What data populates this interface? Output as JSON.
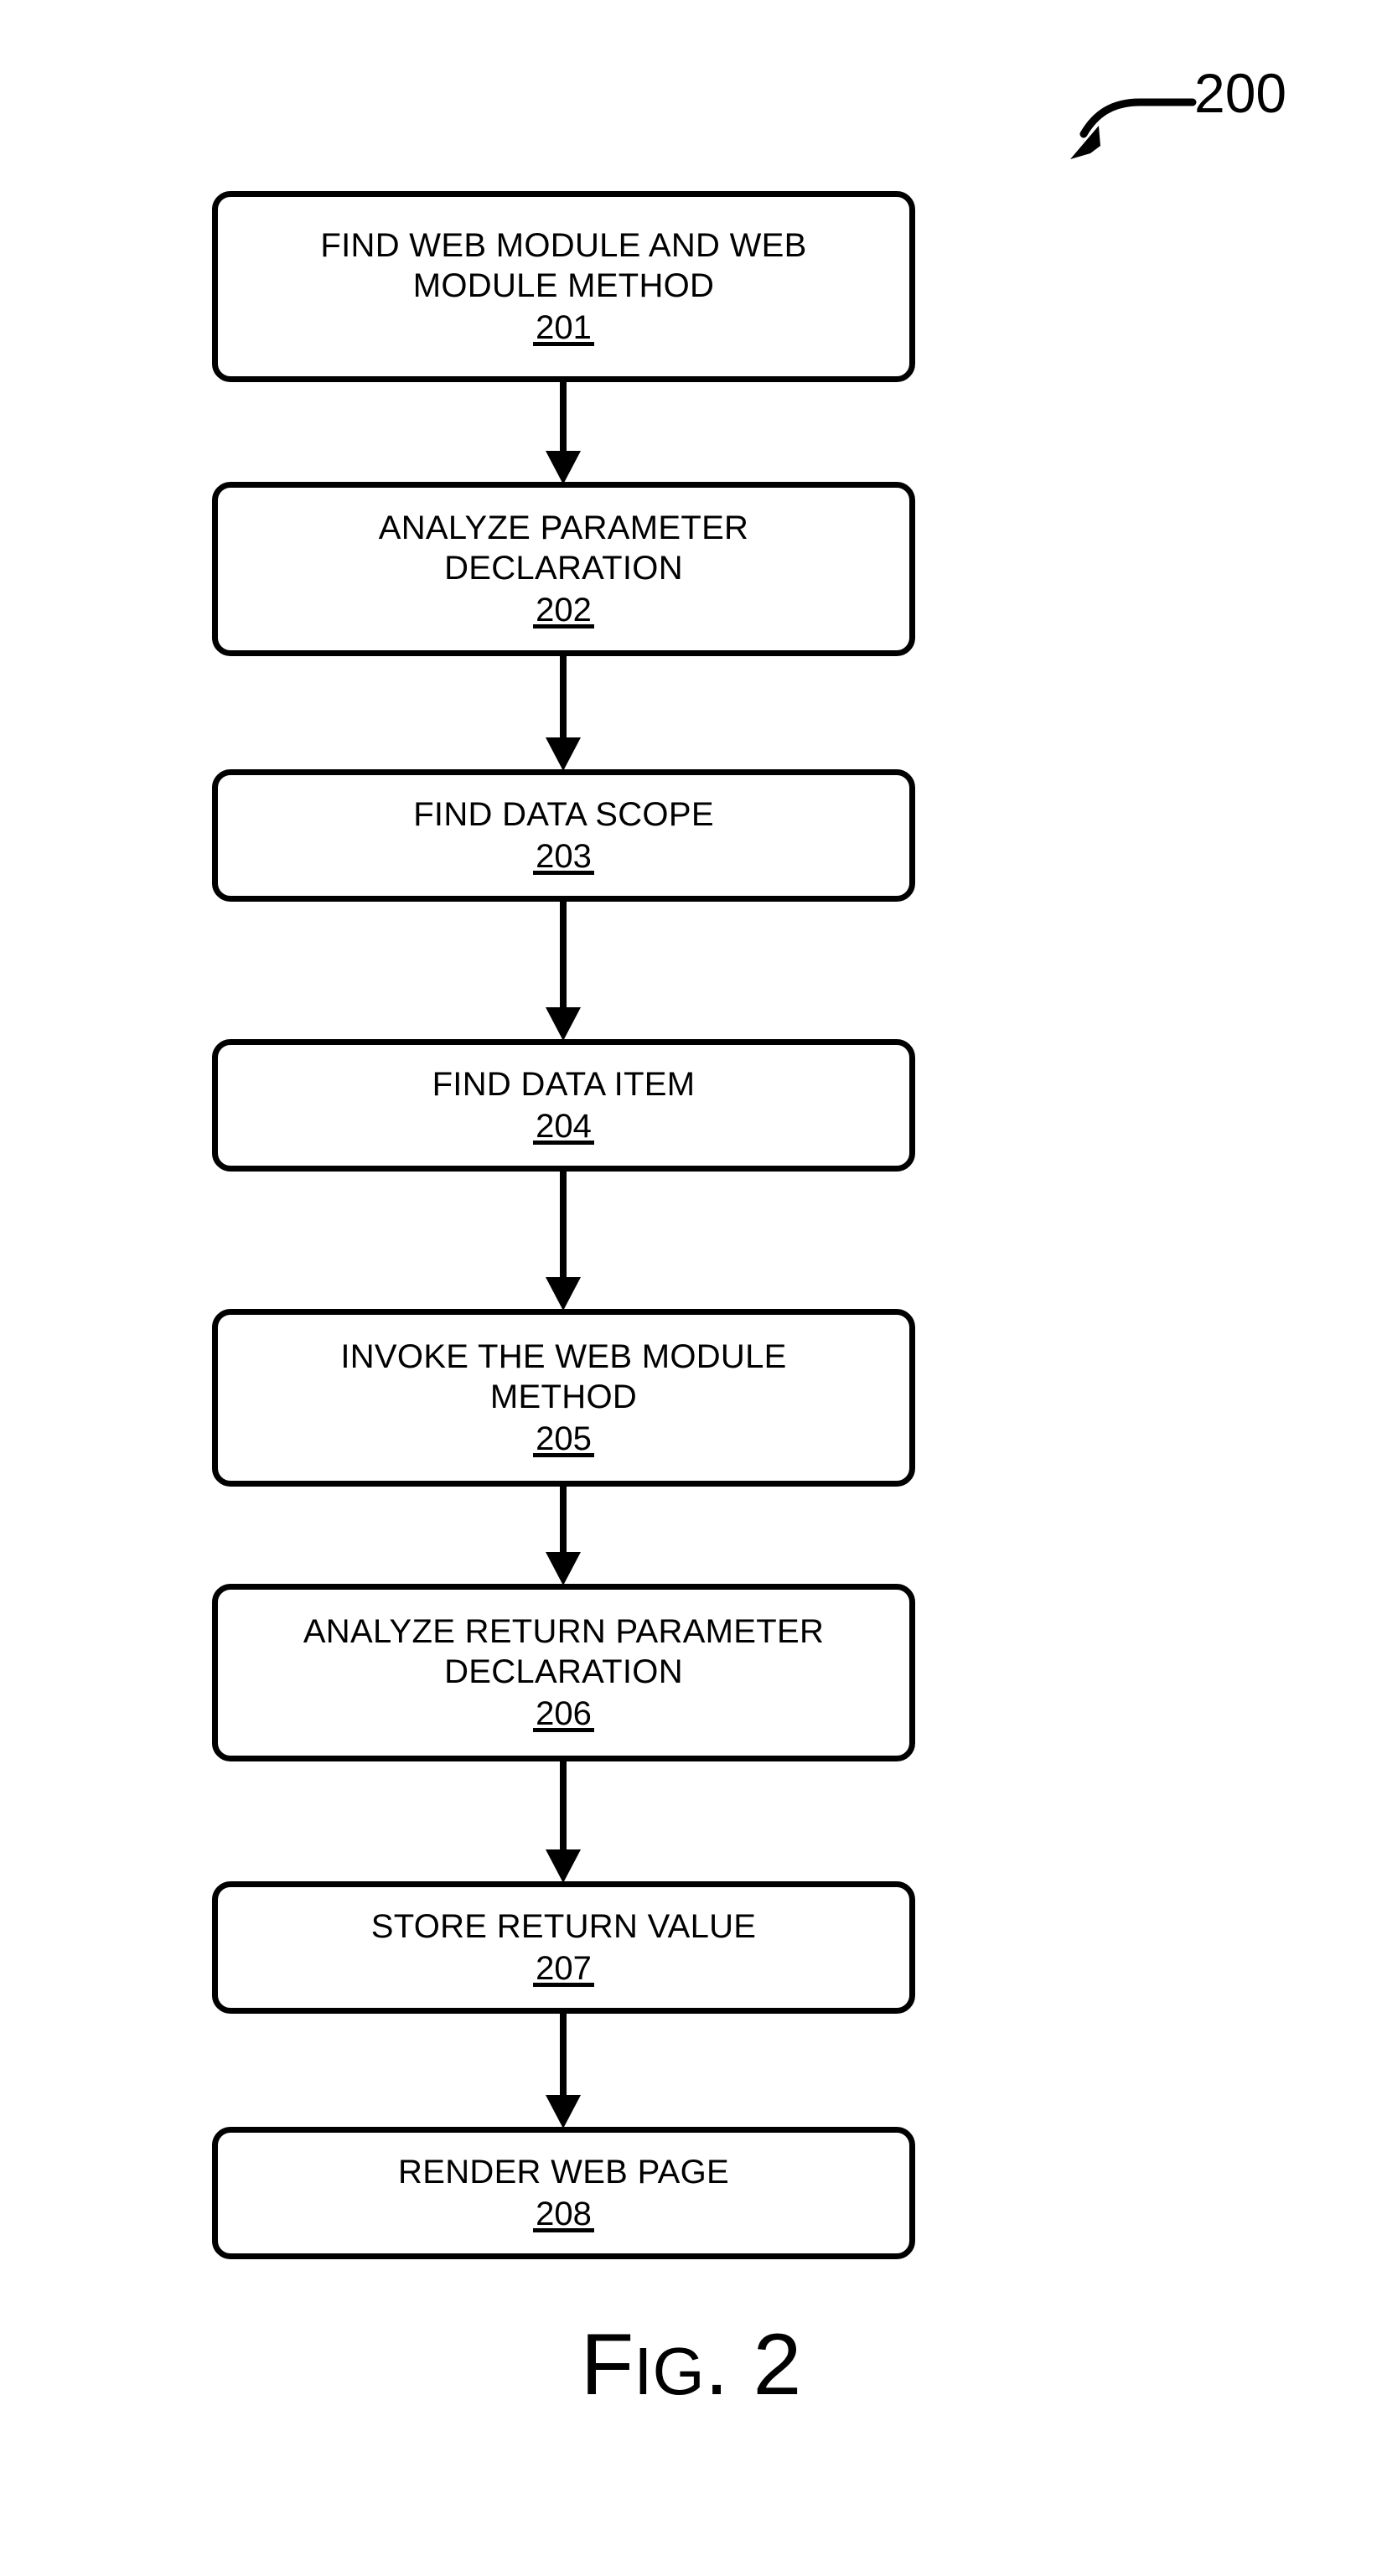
{
  "figure": {
    "reference_label": "200",
    "caption_lead": "F",
    "caption_small": "IG",
    "caption_tail": ". 2",
    "caption_full": "FIG. 2"
  },
  "flowchart": {
    "type": "linear-process-flow",
    "orientation": "top-to-bottom",
    "steps": [
      {
        "title": "FIND WEB MODULE AND WEB\nMODULE METHOD",
        "numeral": "201"
      },
      {
        "title": "ANALYZE PARAMETER\nDECLARATION",
        "numeral": "202"
      },
      {
        "title": "FIND DATA SCOPE",
        "numeral": "203"
      },
      {
        "title": "FIND DATA ITEM",
        "numeral": "204"
      },
      {
        "title": "INVOKE THE WEB MODULE\nMETHOD",
        "numeral": "205"
      },
      {
        "title": "ANALYZE RETURN PARAMETER\nDECLARATION",
        "numeral": "206"
      },
      {
        "title": "STORE RETURN VALUE",
        "numeral": "207"
      },
      {
        "title": "RENDER WEB PAGE",
        "numeral": "208"
      }
    ],
    "connector_count": 7,
    "colors": {
      "stroke": "#000000",
      "fill": "#ffffff",
      "background": "#ffffff"
    }
  }
}
